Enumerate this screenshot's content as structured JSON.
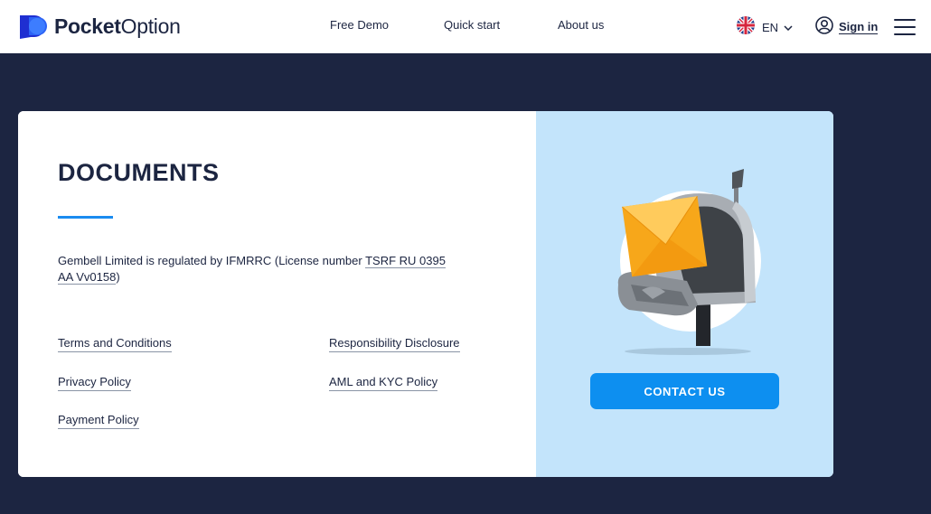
{
  "header": {
    "logo": {
      "bold": "Pocket",
      "light": "Option"
    },
    "nav": [
      {
        "label": "Free Demo"
      },
      {
        "label": "Quick start"
      },
      {
        "label": "About us"
      }
    ],
    "language": {
      "code": "EN",
      "flag_icon": "uk-flag-icon"
    },
    "sign_in_label": "Sign in"
  },
  "documents": {
    "title": "DOCUMENTS",
    "regulation": {
      "text_before": "Gembell Limited is regulated by IFMRRC (License number ",
      "license": "TSRF RU 0395 AA Vv0158",
      "text_after": ")"
    },
    "links": [
      {
        "label": "Terms and Conditions"
      },
      {
        "label": "Responsibility Disclosure"
      },
      {
        "label": "Privacy Policy"
      },
      {
        "label": "AML and KYC Policy"
      },
      {
        "label": "Payment Policy"
      }
    ]
  },
  "contact": {
    "button_label": "CONTACT US",
    "illustration": "mailbox-with-envelope"
  },
  "colors": {
    "page_background": "#1c2541",
    "accent_blue": "#0d8ff0",
    "panel_light_blue": "#c3e4fb",
    "text_dark": "#1c2541"
  }
}
